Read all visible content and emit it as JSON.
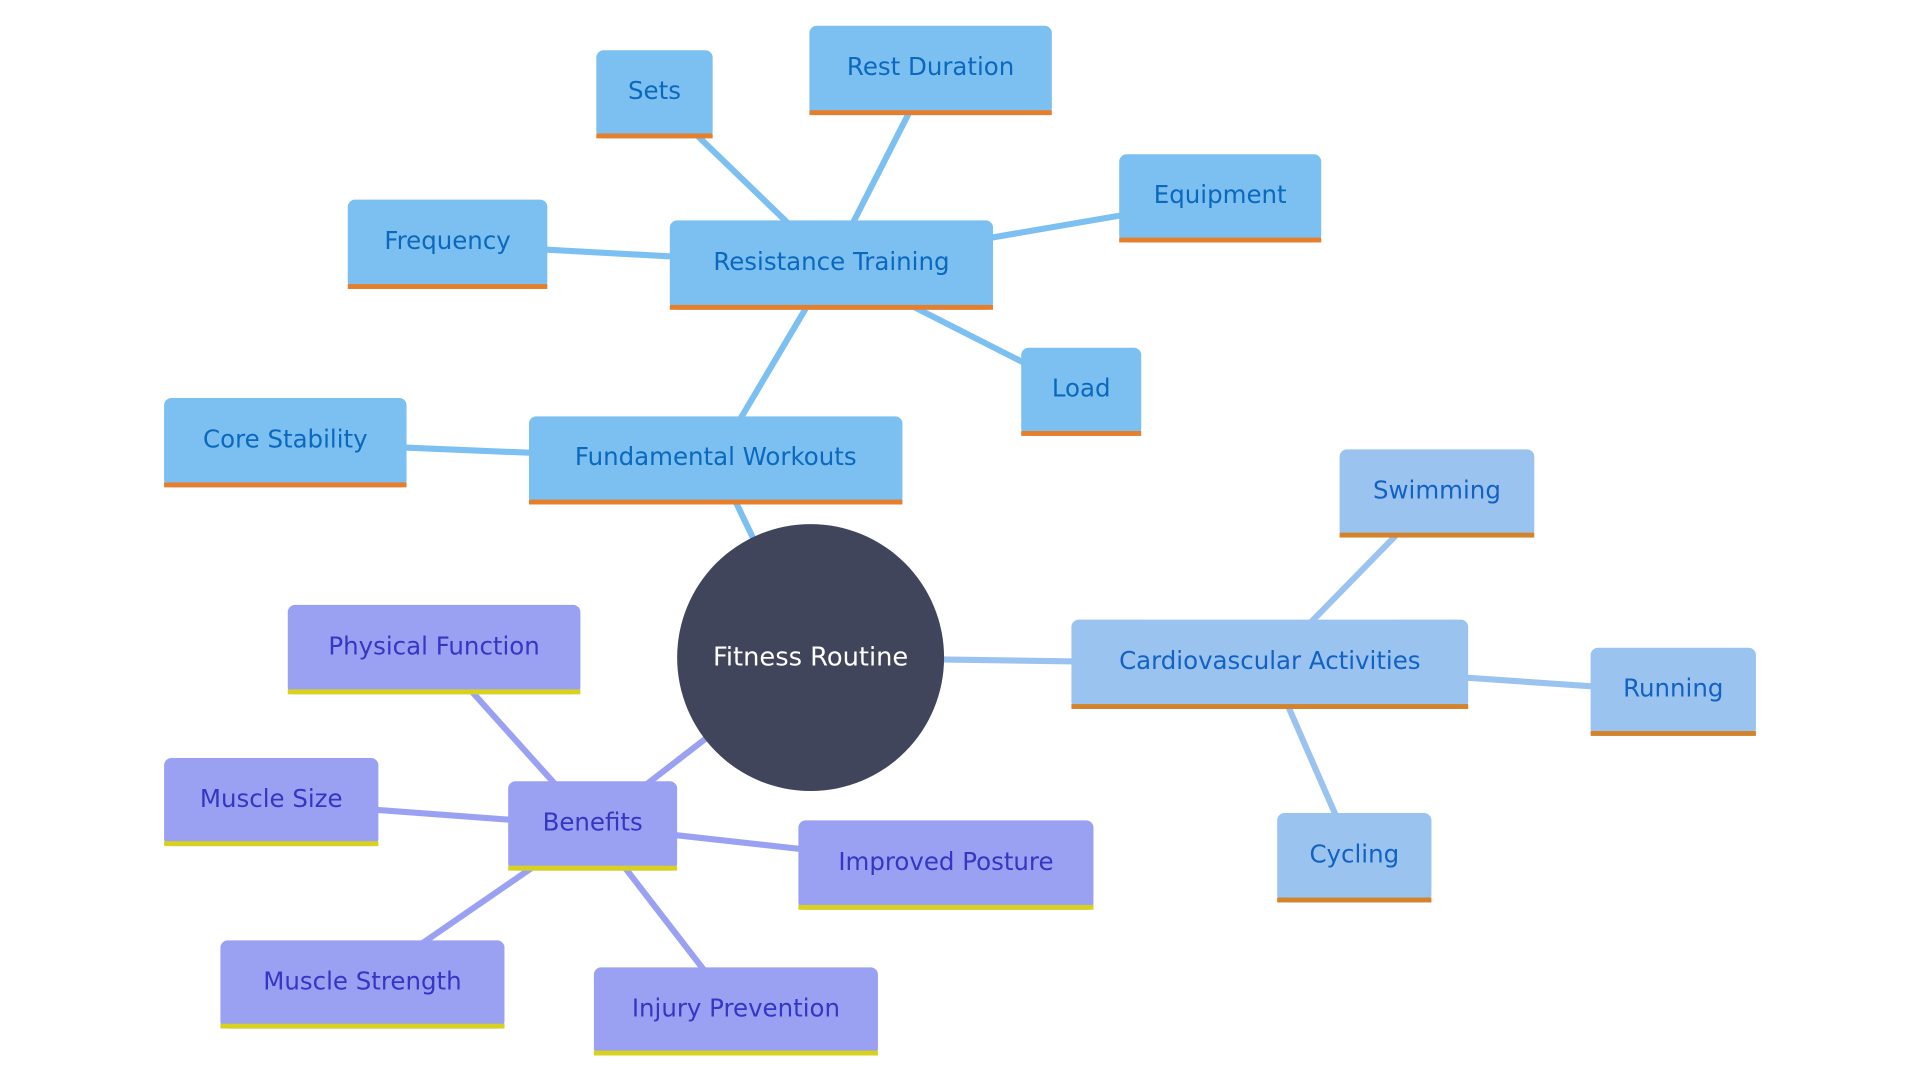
{
  "root": {
    "label": "Fitness Routine",
    "color": "#40455b"
  },
  "palettes": {
    "workouts": {
      "fill": "#7cc0f1",
      "text": "#0b68bd",
      "bar": "#e57f2c",
      "edge": "#7cc0f1"
    },
    "cardio": {
      "fill": "#9bc3ef",
      "text": "#1262c4",
      "bar": "#d4832a",
      "edge": "#9bc3ef"
    },
    "benefits": {
      "fill": "#9ba1f2",
      "text": "#3436c4",
      "bar": "#d8d21f",
      "edge": "#9ba1f2"
    }
  },
  "nodes": [
    {
      "id": "fundamental",
      "label": "Fundamental Workouts",
      "parent": "root",
      "palette": "workouts"
    },
    {
      "id": "resistance",
      "label": "Resistance Training",
      "parent": "fundamental",
      "palette": "workouts"
    },
    {
      "id": "core",
      "label": "Core Stability",
      "parent": "fundamental",
      "palette": "workouts"
    },
    {
      "id": "sets",
      "label": "Sets",
      "parent": "resistance",
      "palette": "workouts"
    },
    {
      "id": "rest",
      "label": "Rest Duration",
      "parent": "resistance",
      "palette": "workouts"
    },
    {
      "id": "equipment",
      "label": "Equipment",
      "parent": "resistance",
      "palette": "workouts"
    },
    {
      "id": "frequency",
      "label": "Frequency",
      "parent": "resistance",
      "palette": "workouts"
    },
    {
      "id": "load",
      "label": "Load",
      "parent": "resistance",
      "palette": "workouts"
    },
    {
      "id": "cardio",
      "label": "Cardiovascular Activities",
      "parent": "root",
      "palette": "cardio"
    },
    {
      "id": "swimming",
      "label": "Swimming",
      "parent": "cardio",
      "palette": "cardio"
    },
    {
      "id": "running",
      "label": "Running",
      "parent": "cardio",
      "palette": "cardio"
    },
    {
      "id": "cycling",
      "label": "Cycling",
      "parent": "cardio",
      "palette": "cardio"
    },
    {
      "id": "benefits",
      "label": "Benefits",
      "parent": "root",
      "palette": "benefits"
    },
    {
      "id": "physical",
      "label": "Physical Function",
      "parent": "benefits",
      "palette": "benefits"
    },
    {
      "id": "size",
      "label": "Muscle Size",
      "parent": "benefits",
      "palette": "benefits"
    },
    {
      "id": "posture",
      "label": "Improved Posture",
      "parent": "benefits",
      "palette": "benefits"
    },
    {
      "id": "strength",
      "label": "Muscle Strength",
      "parent": "benefits",
      "palette": "benefits"
    },
    {
      "id": "injury",
      "label": "Injury Prevention",
      "parent": "benefits",
      "palette": "benefits"
    }
  ]
}
